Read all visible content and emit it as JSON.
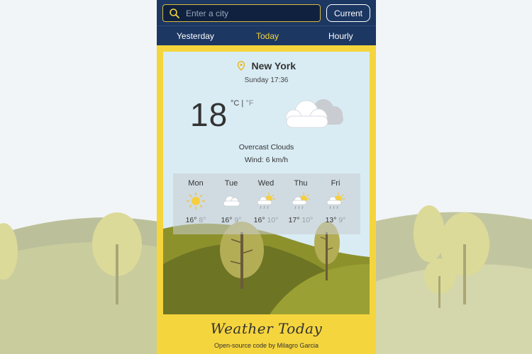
{
  "search": {
    "placeholder": "Enter a city",
    "value": ""
  },
  "current_button": "Current",
  "tabs": [
    {
      "label": "Yesterday",
      "active": false
    },
    {
      "label": "Today",
      "active": true
    },
    {
      "label": "Hourly",
      "active": false
    }
  ],
  "weather": {
    "city": "New York",
    "datetime": "Sunday 17:36",
    "temperature": "18",
    "unit_c": "°C",
    "unit_sep": " | ",
    "unit_f": "°F",
    "condition": "Overcast Clouds",
    "wind": "Wind: 6 km/h",
    "icon": "overcast-clouds-icon"
  },
  "forecast": [
    {
      "day": "Mon",
      "high": "16°",
      "low": "8°",
      "icon": "sun-icon"
    },
    {
      "day": "Tue",
      "high": "16°",
      "low": "9°",
      "icon": "cloud-icon"
    },
    {
      "day": "Wed",
      "high": "16°",
      "low": "10°",
      "icon": "sun-rain-icon"
    },
    {
      "day": "Thu",
      "high": "17°",
      "low": "10°",
      "icon": "sun-rain-icon"
    },
    {
      "day": "Fri",
      "high": "13°",
      "low": "9°",
      "icon": "sun-rain-icon"
    }
  ],
  "footer": {
    "title": "Weather Today",
    "credit": "Open-source code by Milagro Garcia"
  },
  "colors": {
    "navy": "#1c3762",
    "yellow": "#f5d53d",
    "sky": "#d9ecf4",
    "hill_dark": "#6d7424",
    "hill_light": "#8d912c",
    "tree": "#c8c57a"
  }
}
